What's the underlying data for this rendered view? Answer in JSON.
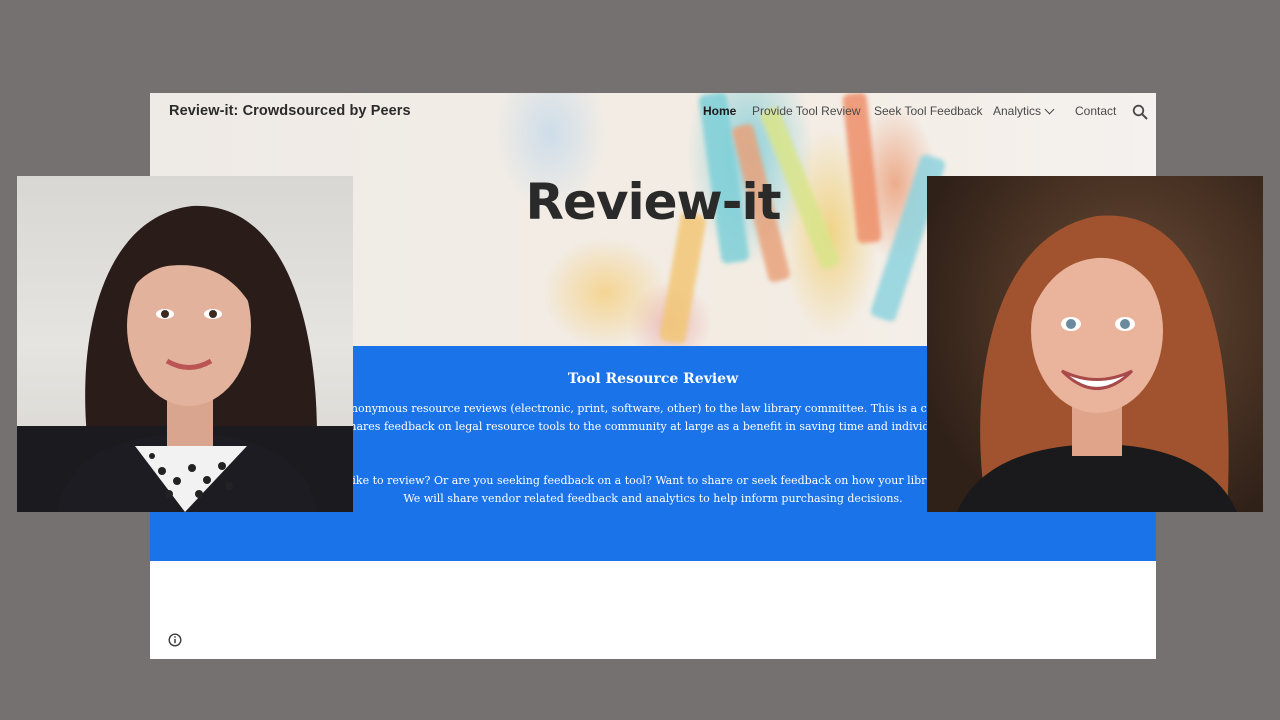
{
  "site": {
    "title": "Review-it: Crowdsourced by Peers",
    "nav": {
      "home": "Home",
      "provide": "Provide Tool Review",
      "seek": "Seek Tool Feedback",
      "analytics": "Analytics",
      "contact": "Contact"
    },
    "hero_title": "Review-it",
    "section": {
      "heading": "Tool Resource Review",
      "line1": "nonymous resource reviews (electronic, print, software, other) to the law library committee. This is a crowd",
      "line2": "hares feedback on legal resource tools to the community at large as a benefit in saving time and individual a",
      "line3": " like to review? Or are you seeking feedback on a tool? Want to share or seek feedback on how your library is",
      "line4": "We will share vendor related feedback and analytics to help inform purchasing decisions."
    }
  },
  "colors": {
    "backdrop": "#757170",
    "accent_blue": "#1a73e8",
    "page": "#ffffff"
  },
  "icons": {
    "search": "search-icon",
    "dropdown": "chevron-down-icon",
    "info": "info-icon"
  }
}
